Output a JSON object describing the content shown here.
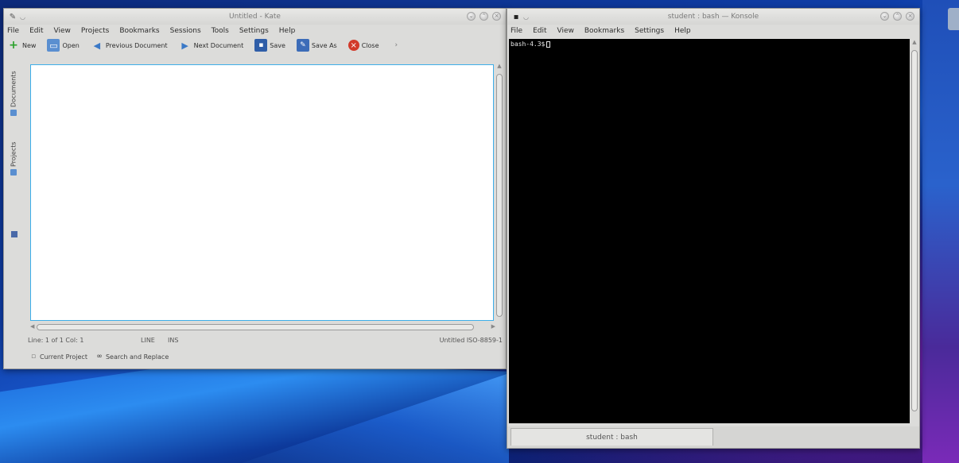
{
  "kate": {
    "title": "Untitled - Kate",
    "menu": [
      "File",
      "Edit",
      "View",
      "Projects",
      "Bookmarks",
      "Sessions",
      "Tools",
      "Settings",
      "Help"
    ],
    "toolbar": {
      "new": "New",
      "open": "Open",
      "previous": "Previous Document",
      "next": "Next Document",
      "save": "Save",
      "save_as": "Save As",
      "close": "Close"
    },
    "side_tabs": {
      "documents": "Documents",
      "projects": "Projects"
    },
    "status": {
      "position": "Line: 1 of 1 Col: 1",
      "mode": "LINE",
      "insert": "INS",
      "right": "Untitled  ISO-8859-1"
    },
    "bottom_tabs": {
      "current_project": "Current Project",
      "search": "Search and Replace"
    }
  },
  "konsole": {
    "title": "student : bash — Konsole",
    "menu": [
      "File",
      "Edit",
      "View",
      "Bookmarks",
      "Settings",
      "Help"
    ],
    "prompt": "bash-4.3$",
    "tab_label": "student : bash"
  },
  "colors": {
    "editor_focus": "#3daee9",
    "terminal_bg": "#000000",
    "window_bg": "#dcdcda"
  }
}
